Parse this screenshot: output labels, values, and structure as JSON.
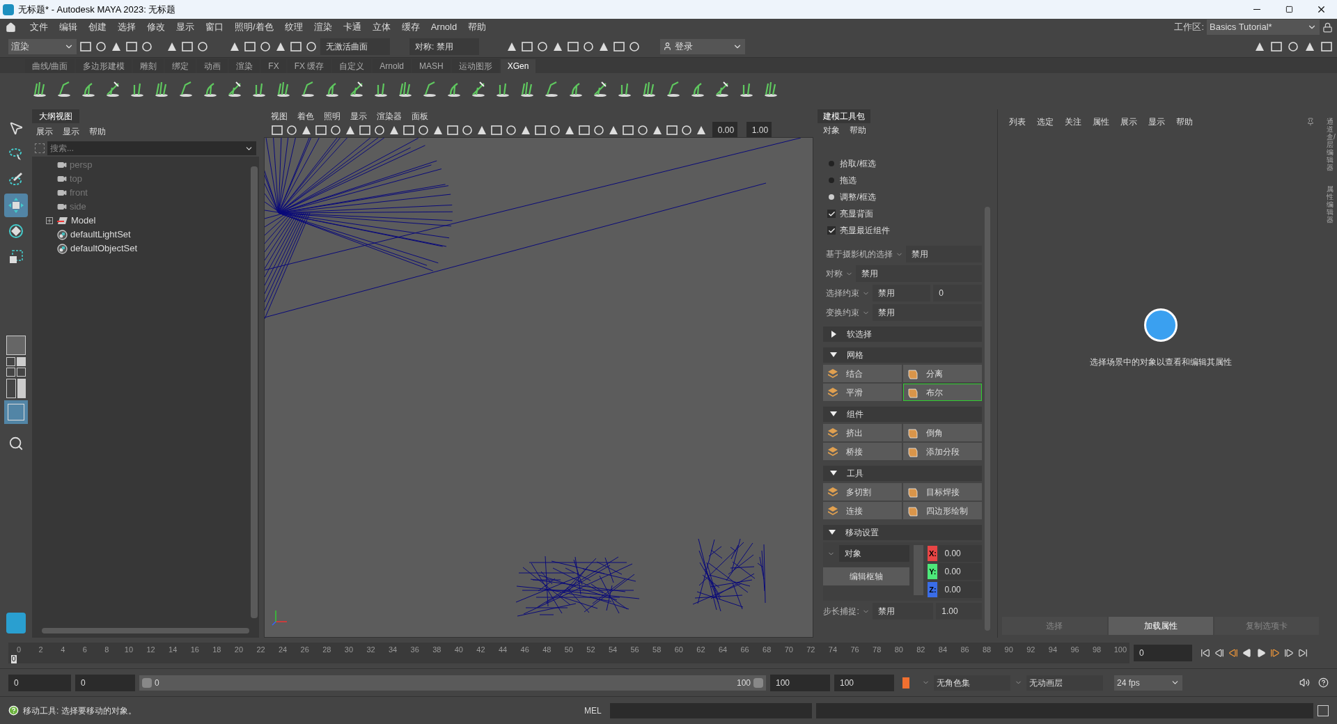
{
  "window": {
    "title": "无标题* - Autodesk MAYA 2023: 无标题"
  },
  "menu": [
    "文件",
    "编辑",
    "创建",
    "选择",
    "修改",
    "显示",
    "窗口",
    "照明/着色",
    "纹理",
    "渲染",
    "卡通",
    "立体",
    "缓存",
    "Arnold",
    "帮助"
  ],
  "workspace": {
    "label": "工作区:",
    "value": "Basics Tutorial*"
  },
  "toolbar": {
    "mode": "渲染",
    "live_surface": "无激活曲面",
    "symmetry": "对称: 禁用",
    "login": "登录"
  },
  "shelf_tabs": [
    {
      "label": "曲线/曲面",
      "selected": false
    },
    {
      "label": "多边形建模",
      "selected": false
    },
    {
      "label": "雕刻",
      "selected": false
    },
    {
      "label": "绑定",
      "selected": false
    },
    {
      "label": "动画",
      "selected": false
    },
    {
      "label": "渲染",
      "selected": false
    },
    {
      "label": "FX",
      "selected": false
    },
    {
      "label": "FX 缓存",
      "selected": false
    },
    {
      "label": "自定义",
      "selected": false
    },
    {
      "label": "Arnold",
      "selected": false
    },
    {
      "label": "MASH",
      "selected": false
    },
    {
      "label": "运动图形",
      "selected": false
    },
    {
      "label": "XGen",
      "selected": true
    }
  ],
  "toolbox": [
    {
      "kind": "select",
      "selected": false
    },
    {
      "kind": "lasso",
      "selected": false
    },
    {
      "kind": "paint",
      "selected": false
    },
    {
      "kind": "move",
      "selected": true
    },
    {
      "kind": "rotate",
      "selected": false
    },
    {
      "kind": "scale",
      "selected": false
    }
  ],
  "outliner": {
    "tab": "大纲视图",
    "menu": [
      "展示",
      "显示",
      "帮助"
    ],
    "search": {
      "placeholder": "搜索..."
    },
    "items": [
      {
        "kind": "camera",
        "label": "persp",
        "hidden": true
      },
      {
        "kind": "camera",
        "label": "top",
        "hidden": true
      },
      {
        "kind": "camera",
        "label": "front",
        "hidden": true
      },
      {
        "kind": "camera",
        "label": "side",
        "hidden": true
      },
      {
        "kind": "group",
        "label": "Model",
        "hidden": false,
        "expanded": false
      },
      {
        "kind": "set",
        "label": "defaultLightSet",
        "hidden": false
      },
      {
        "kind": "set",
        "label": "defaultObjectSet",
        "hidden": false
      }
    ]
  },
  "viewport": {
    "menu": [
      "视图",
      "着色",
      "照明",
      "显示",
      "渲染器",
      "面板"
    ],
    "exposure": "0.00",
    "gamma": "1.00"
  },
  "toolkit": {
    "tab": "建模工具包",
    "menu": [
      "对象",
      "帮助"
    ],
    "radios": [
      {
        "label": "拾取/框选",
        "selected": false
      },
      {
        "label": "拖选",
        "selected": false
      },
      {
        "label": "调整/框选",
        "selected": true
      }
    ],
    "checks": [
      {
        "label": "亮显背面",
        "checked": true
      },
      {
        "label": "亮显最近组件",
        "checked": true
      }
    ],
    "options": [
      {
        "label": "基于摄影机的选择",
        "value": "禁用"
      },
      {
        "label": "对称",
        "value": "禁用"
      },
      {
        "label": "选择约束",
        "value": "禁用",
        "extra": "0"
      },
      {
        "label": "变换约束",
        "value": "禁用"
      }
    ],
    "sections": [
      {
        "title": "软选择",
        "expanded": false
      },
      {
        "title": "网格",
        "expanded": true,
        "buttons": [
          {
            "label": "结合",
            "active": false
          },
          {
            "label": "分离",
            "active": false
          },
          {
            "label": "平滑",
            "active": false
          },
          {
            "label": "布尔",
            "active": true
          }
        ]
      },
      {
        "title": "组件",
        "expanded": true,
        "buttons": [
          {
            "label": "挤出",
            "active": false
          },
          {
            "label": "倒角",
            "active": false
          },
          {
            "label": "桥接",
            "active": false
          },
          {
            "label": "添加分段",
            "active": false
          }
        ]
      },
      {
        "title": "工具",
        "expanded": true,
        "buttons": [
          {
            "label": "多切割",
            "active": false
          },
          {
            "label": "目标焊接",
            "active": false
          },
          {
            "label": "连接",
            "active": false
          },
          {
            "label": "四边形绘制",
            "active": false
          }
        ]
      }
    ],
    "move": {
      "title": "移动设置",
      "expanded": true,
      "space": "对象",
      "pivot_button": "编辑枢轴",
      "axes": [
        {
          "label": "X:",
          "color": "#e84545",
          "value": "0.00"
        },
        {
          "label": "Y:",
          "color": "#4de87a",
          "value": "0.00"
        },
        {
          "label": "Z:",
          "color": "#3a6de8",
          "value": "0.00"
        }
      ],
      "snap_label": "步长捕捉:",
      "snap_value": "禁用",
      "snap_step": "1.00"
    }
  },
  "attribute_editor": {
    "menu": [
      "列表",
      "选定",
      "关注",
      "属性",
      "展示",
      "显示",
      "帮助"
    ],
    "message": "选择场景中的对象以查看和编辑其属性",
    "buttons": [
      {
        "label": "选择",
        "selected": false
      },
      {
        "label": "加载属性",
        "selected": true
      },
      {
        "label": "复制选项卡",
        "selected": false
      }
    ]
  },
  "side_tabs": [
    "通道盒/层编辑器",
    "属性编辑器"
  ],
  "timeline": {
    "ticks": [
      "0",
      "2",
      "4",
      "6",
      "8",
      "10",
      "12",
      "14",
      "16",
      "18",
      "20",
      "22",
      "24",
      "26",
      "28",
      "30",
      "32",
      "34",
      "36",
      "38",
      "40",
      "42",
      "44",
      "46",
      "48",
      "50",
      "52",
      "54",
      "56",
      "58",
      "60",
      "62",
      "64",
      "66",
      "68",
      "70",
      "72",
      "74",
      "76",
      "78",
      "80",
      "82",
      "84",
      "86",
      "88",
      "90",
      "92",
      "94",
      "96",
      "98",
      "100"
    ],
    "current": "0",
    "level": 0,
    "frame_field": "0"
  },
  "range": {
    "start": "0",
    "playback_start": "0",
    "slider_start": "0",
    "slider_end": "100",
    "level": 1,
    "playback_end": "100",
    "end": "100",
    "character_set": "无角色集",
    "anim_layer": "无动画层",
    "fps": "24 fps"
  },
  "status": {
    "help": "移动工具: 选择要移动的对象。",
    "command_label": "MEL"
  }
}
